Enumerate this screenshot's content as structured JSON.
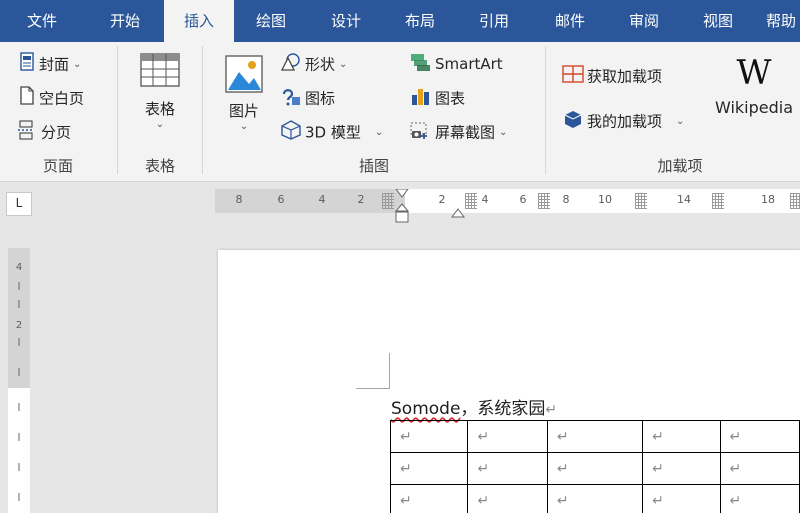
{
  "tabs": [
    "文件",
    "开始",
    "插入",
    "绘图",
    "设计",
    "布局",
    "引用",
    "邮件",
    "审阅",
    "视图",
    "帮助"
  ],
  "active_tab": "插入",
  "ribbon": {
    "pages": {
      "cover": "封面",
      "blank_page": "空白页",
      "page_break": "分页",
      "group_label": "页面"
    },
    "tables": {
      "table": "表格",
      "group_label": "表格"
    },
    "illustrations": {
      "pictures": "图片",
      "shapes": "形状",
      "icons": "图标",
      "model_3d": "3D 模型",
      "smartart": "SmartArt",
      "chart": "图表",
      "screenshot": "屏幕截图",
      "group_label": "插图"
    },
    "addins": {
      "get_addins": "获取加载项",
      "my_addins": "我的加载项",
      "wikipedia": "Wikipedia",
      "wikipedia_logo": "W",
      "group_label": "加载项"
    }
  },
  "ruler": {
    "corner_glyph": "L",
    "left_ticks": [
      "8",
      "6",
      "4",
      "2"
    ],
    "right_ticks": [
      "2",
      "4",
      "6",
      "8",
      "10",
      "14",
      "18"
    ],
    "vertical_ticks": [
      "4",
      "2"
    ]
  },
  "document": {
    "line_word": "Somode",
    "line_rest": "，系统家园",
    "paragraph_mark": "↵",
    "cell_mark": "↵",
    "table_rows": 3,
    "table_cols": 5
  },
  "colors": {
    "tab_bar": "#2b579a",
    "ribbon_bg": "#f3f3f3",
    "accent_red": "#d24726",
    "accent_blue": "#2b579a"
  }
}
